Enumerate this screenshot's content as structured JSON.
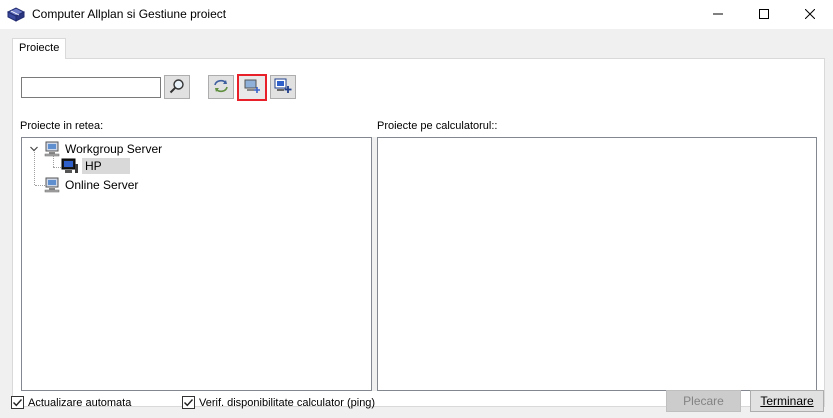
{
  "window": {
    "title": "Computer Allplan si Gestiune proiect"
  },
  "tabs": [
    {
      "label": "Proiecte",
      "active": true
    }
  ],
  "toolbar": {
    "search_value": "",
    "search_icon": "magnifier-icon",
    "buttons": [
      {
        "name": "refresh-button",
        "icon": "refresh-arrows-icon"
      },
      {
        "name": "add-computer-button",
        "icon": "add-computer-icon",
        "highlighted": true,
        "highlight_color": "#e8202a"
      },
      {
        "name": "add-project-button",
        "icon": "add-project-icon"
      }
    ]
  },
  "network": {
    "label": "Proiecte in retea:",
    "tree": [
      {
        "label": "Workgroup Server",
        "expanded": true,
        "icon": "server-icon",
        "children": [
          {
            "label": "HP",
            "icon": "computer-icon",
            "selected": true
          }
        ]
      },
      {
        "label": "Online Server",
        "icon": "server-icon"
      }
    ]
  },
  "local": {
    "label": "Proiecte pe calculatorul::"
  },
  "footer": {
    "auto_update_label": "Actualizare automata",
    "auto_update_checked": true,
    "ping_label": "Verif. disponibilitate calculator (ping)",
    "ping_checked": true,
    "plecare_label": "Plecare",
    "plecare_enabled": false,
    "terminare_label": "Terminare"
  },
  "colors": {
    "highlight": "#e8202a",
    "selection": "#d9d9d9",
    "background": "#f0f0f0"
  }
}
